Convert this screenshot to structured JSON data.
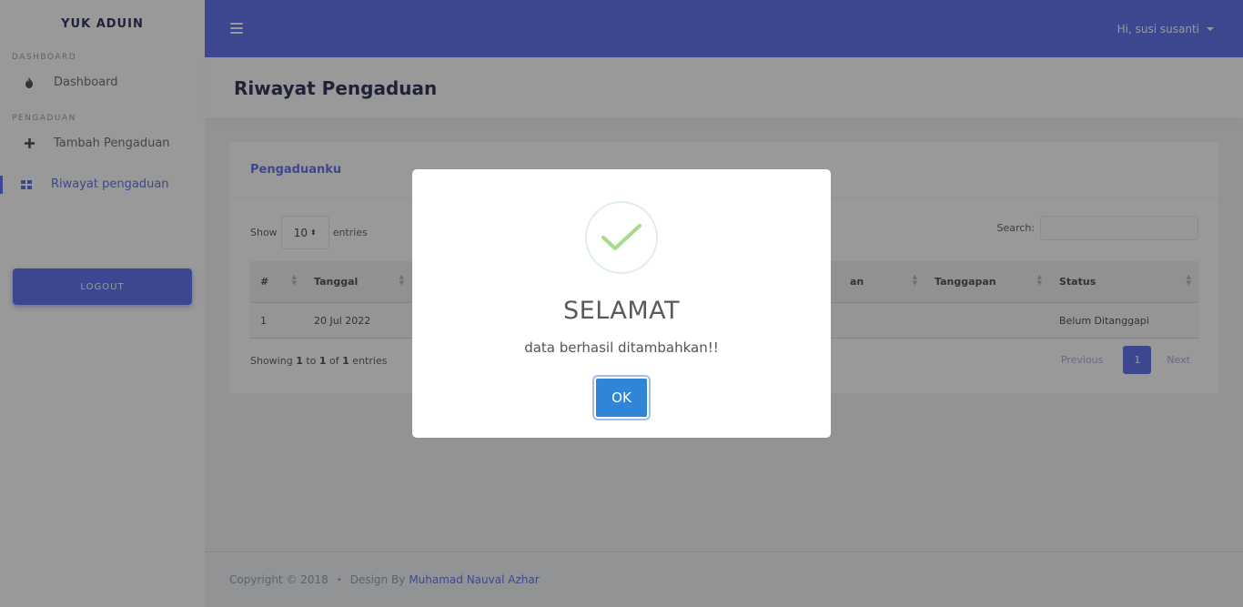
{
  "sidebar": {
    "brand": "YUK ADUIN",
    "sections": [
      {
        "header": "DASHBOARD",
        "items": [
          {
            "label": "Dashboard",
            "icon": "fire-icon"
          }
        ]
      },
      {
        "header": "PENGADUAN",
        "items": [
          {
            "label": "Tambah Pengaduan",
            "icon": "plus-icon"
          },
          {
            "label": "Riwayat pengaduan",
            "icon": "grid-icon",
            "active": true
          }
        ]
      }
    ],
    "logout_label": "LOGOUT"
  },
  "navbar": {
    "user_greeting": "Hi, susi susanti"
  },
  "section": {
    "title": "Riwayat Pengaduan"
  },
  "card": {
    "title": "Pengaduanku",
    "show_label": "Show",
    "entries_value": "10",
    "entries_label": "entries",
    "search_label": "Search:",
    "table": {
      "headers": [
        "#",
        "Tanggal",
        "",
        "an",
        "Tanggapan",
        "Status"
      ],
      "rows": [
        [
          "1",
          "20 Jul 2022",
          "",
          "",
          "",
          "Belum Ditanggapi"
        ]
      ]
    },
    "info": {
      "prefix": "Showing ",
      "from": "1",
      "to_word": " to ",
      "to": "1",
      "of_word": " of ",
      "total": "1",
      "suffix": " entries"
    },
    "pagination": {
      "previous": "Previous",
      "current": "1",
      "next": "Next"
    }
  },
  "footer": {
    "copyright": "Copyright © 2018",
    "separator": "•",
    "design_by": "Design By",
    "author": "Muhamad Nauval Azhar"
  },
  "modal": {
    "title": "SELAMAT",
    "message": "data berhasil ditambahkan!!",
    "ok_label": "OK"
  },
  "colors": {
    "primary": "#6777ef",
    "ok_button": "#3085d6",
    "success": "#a5dc86"
  }
}
